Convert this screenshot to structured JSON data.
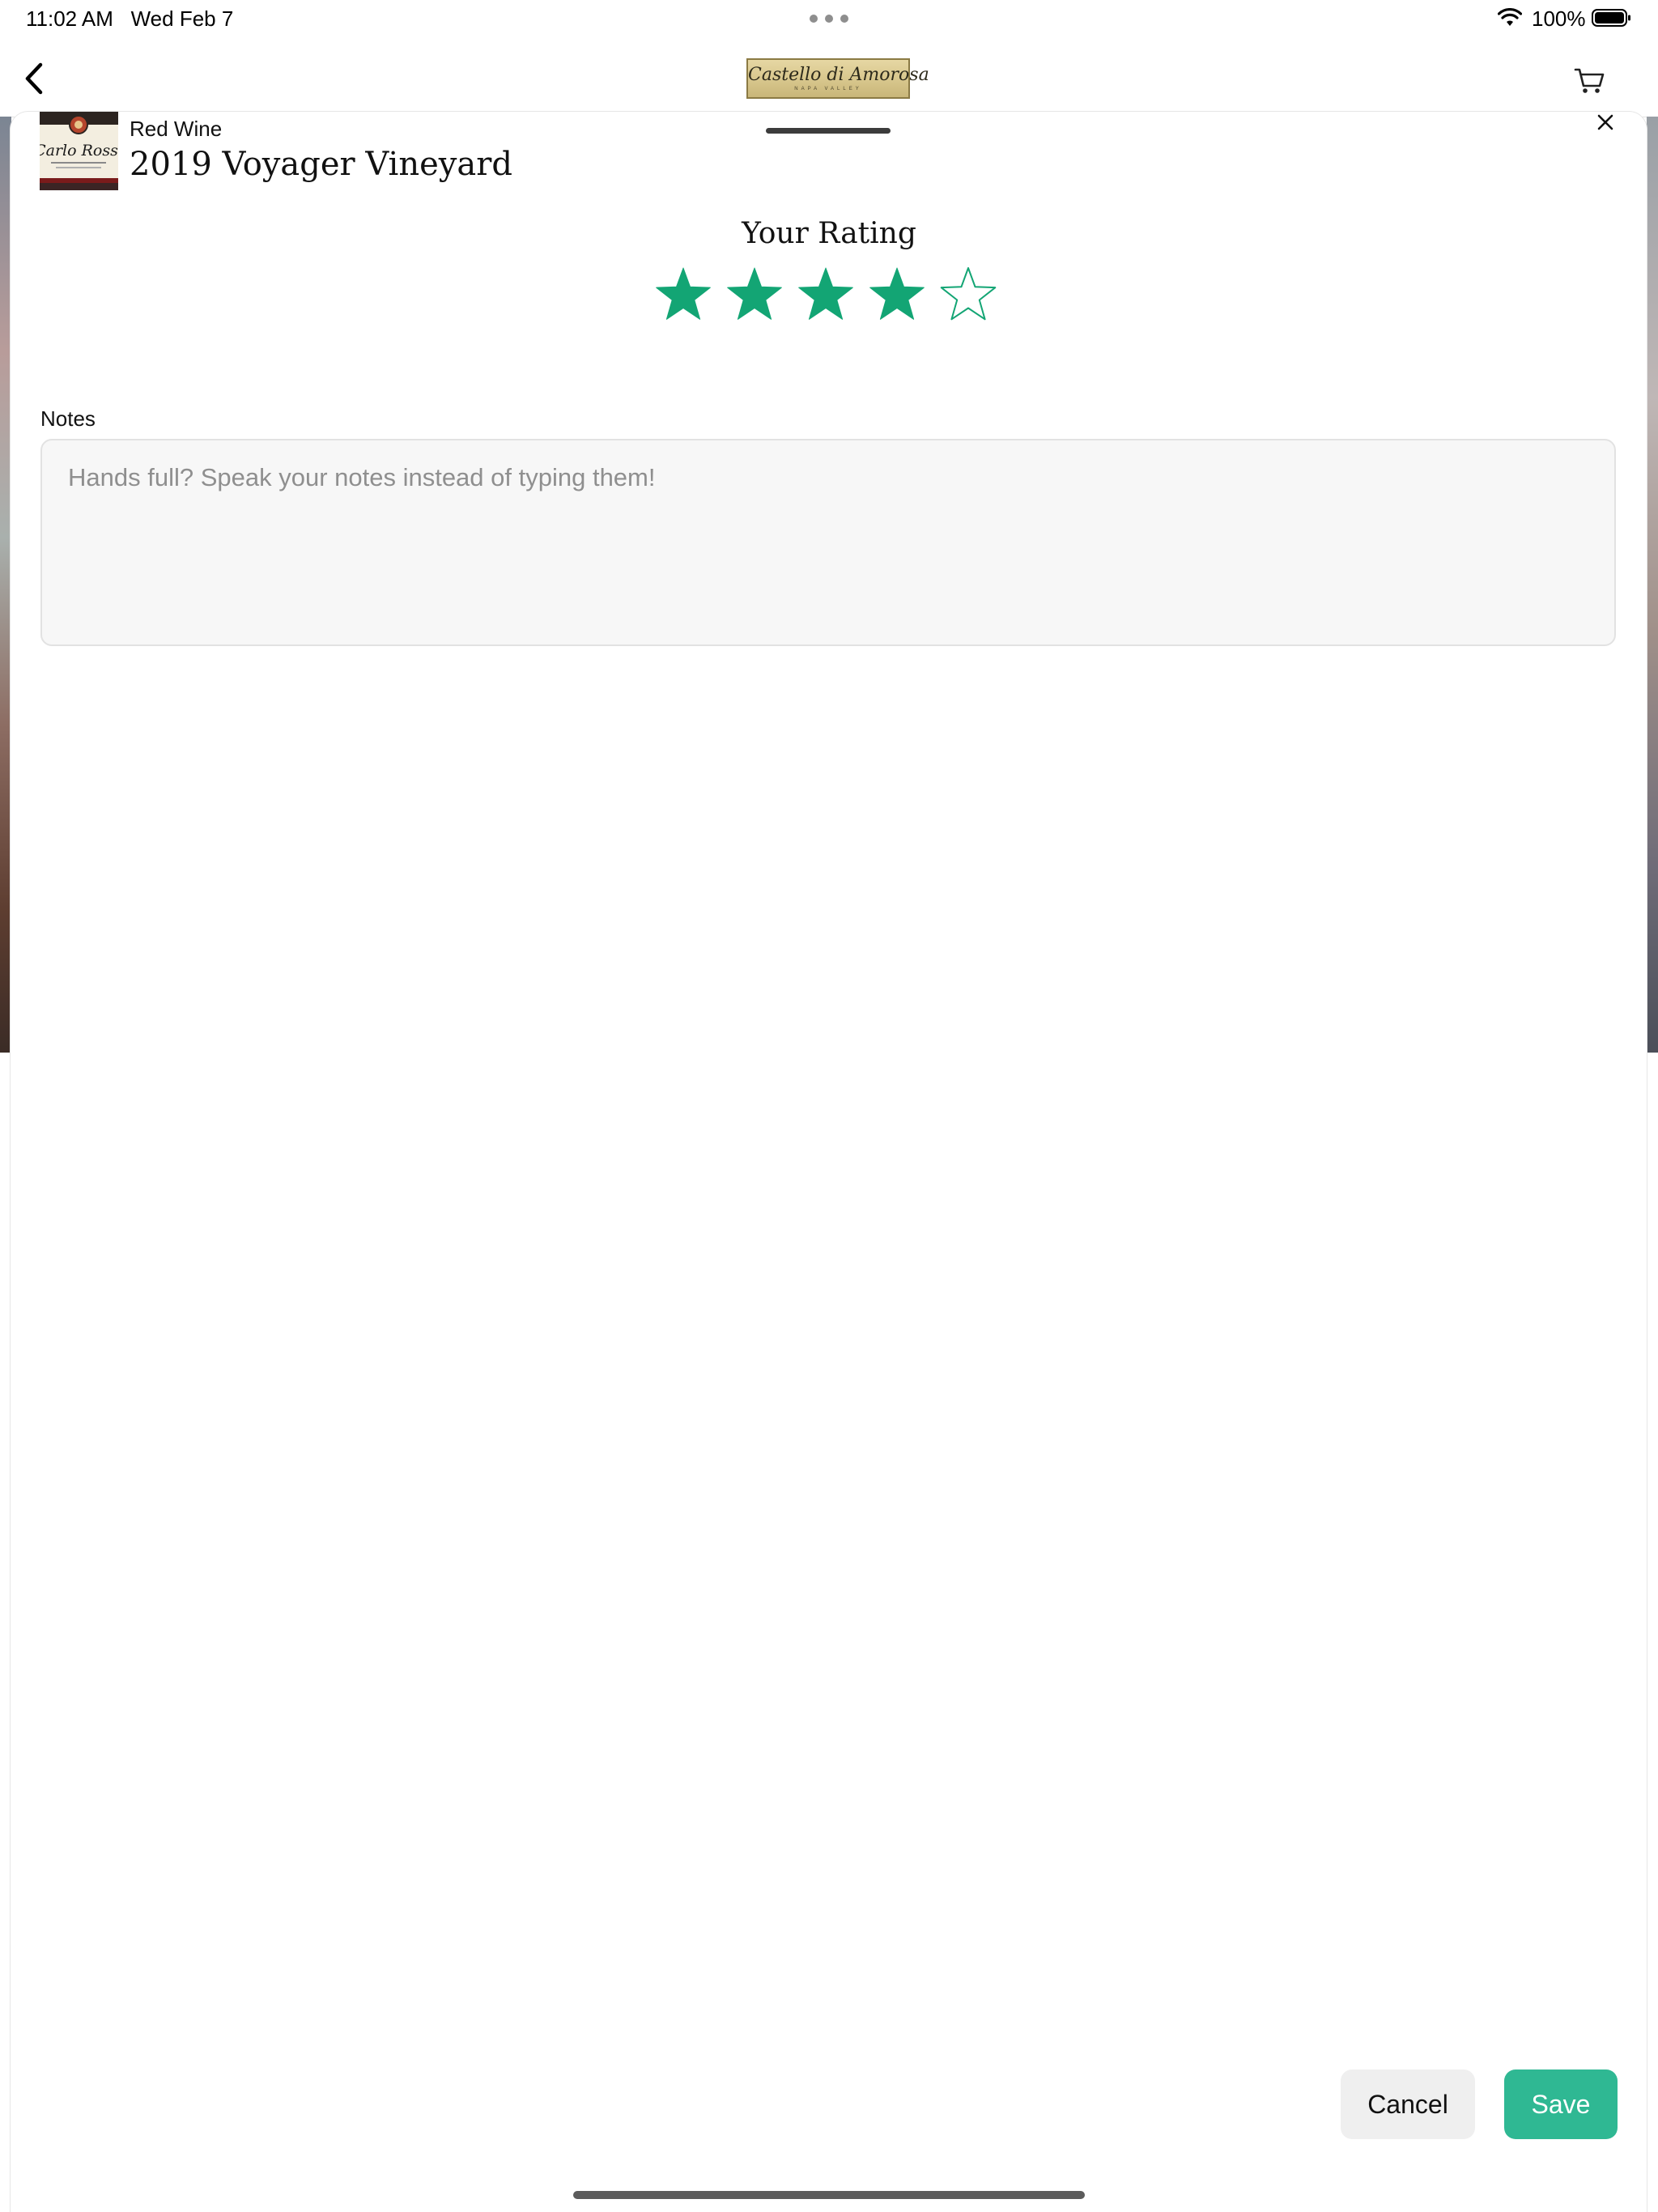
{
  "status_bar": {
    "time": "11:02 AM",
    "date": "Wed Feb 7",
    "battery": "100%",
    "wifi_icon": "wifi-icon",
    "battery_icon": "battery-full-icon"
  },
  "nav": {
    "back_icon": "chevron-left-icon",
    "logo_text": "Castello di Amorosa",
    "logo_subtext": "NAPA VALLEY",
    "cart_icon": "cart-icon"
  },
  "sheet": {
    "close_icon": "close-icon",
    "wine": {
      "category": "Red Wine",
      "name": "2019 Voyager Vineyard",
      "thumb_label": "Carlo Rossi"
    },
    "rating": {
      "title": "Your Rating",
      "value": 4,
      "max": 5,
      "filled_color": "#13a574",
      "empty_color": "#13a574"
    },
    "notes": {
      "label": "Notes",
      "placeholder": "Hands full? Speak your notes instead of typing them!",
      "value": ""
    },
    "actions": {
      "cancel_label": "Cancel",
      "save_label": "Save",
      "save_color": "#2fb893"
    }
  }
}
